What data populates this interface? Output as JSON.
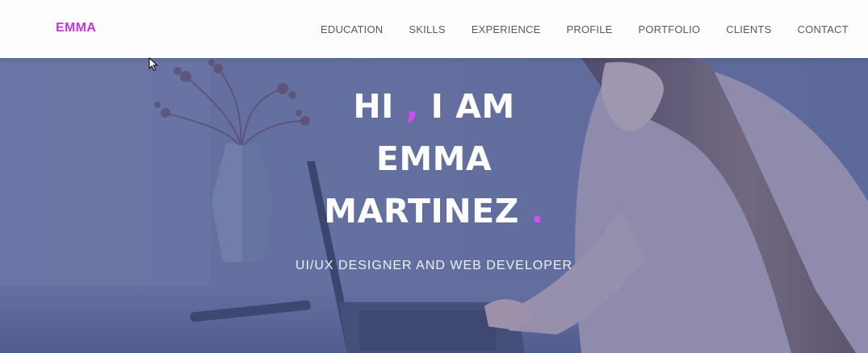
{
  "brand": {
    "name": "EMMA"
  },
  "nav": {
    "items": [
      {
        "label": "EDUCATION"
      },
      {
        "label": "SKILLS"
      },
      {
        "label": "EXPERIENCE"
      },
      {
        "label": "PROFILE"
      },
      {
        "label": "PORTFOLIO"
      },
      {
        "label": "CLIENTS"
      },
      {
        "label": "CONTACT"
      }
    ]
  },
  "hero": {
    "line1_part1": "HI",
    "line1_comma": ",",
    "line1_part2": "I AM",
    "line2": "EMMA",
    "line3": "MARTINEZ",
    "line3_dot": ".",
    "subtitle": "UI/UX DESIGNER AND WEB DEVELOPER"
  },
  "colors": {
    "accent": "#d24cf0",
    "brand": "#c23ad6",
    "nav_text": "#5a5a5a",
    "hero_text": "#ffffff"
  },
  "icons": {
    "cursor": "mouse-pointer-icon"
  }
}
